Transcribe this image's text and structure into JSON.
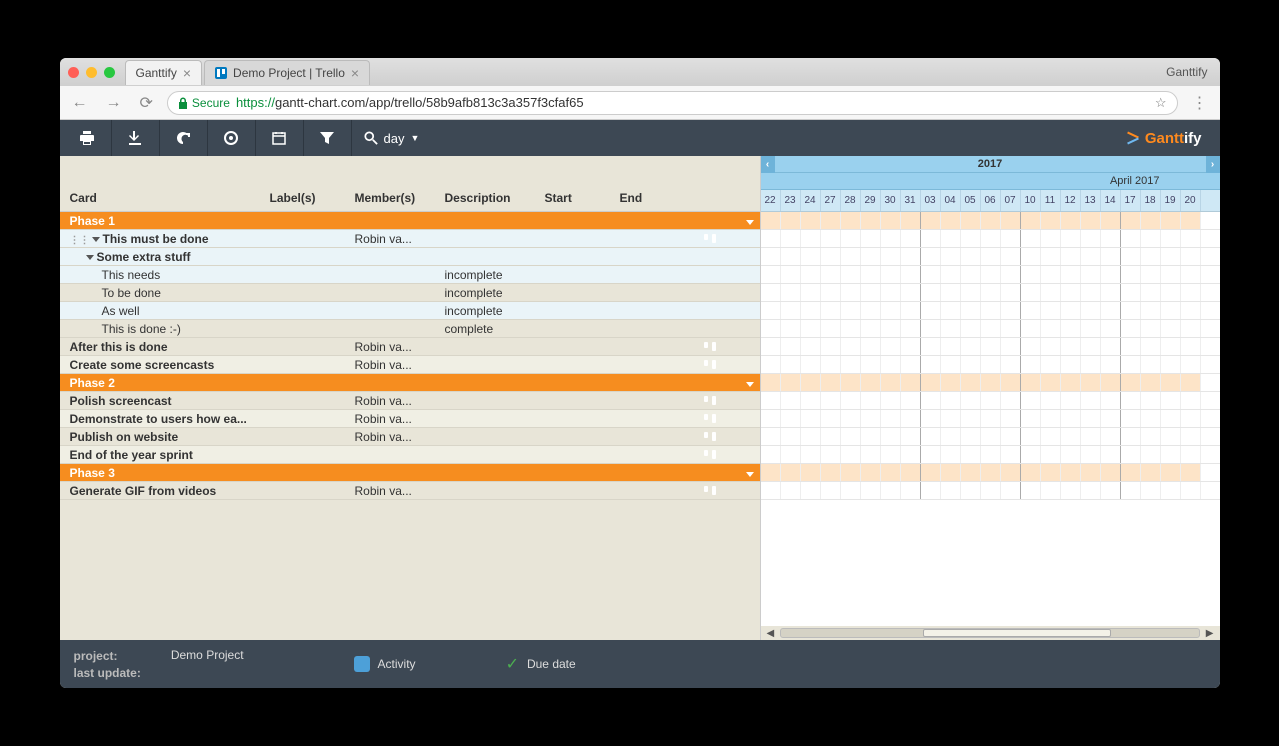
{
  "browser": {
    "tabs": [
      {
        "title": "Ganttify",
        "active": true
      },
      {
        "title": "Demo Project | Trello",
        "active": false
      }
    ],
    "win_label": "Ganttify",
    "secure_label": "Secure",
    "url_https": "https://",
    "url_rest": "gantt-chart.com/app/trello/58b9afb813c3a357f3cfaf65"
  },
  "toolbar": {
    "zoom_label": "day"
  },
  "brand": {
    "part1": "Gantt",
    "part2": "ify"
  },
  "columns": {
    "card": "Card",
    "label": "Label(s)",
    "member": "Member(s)",
    "desc": "Description",
    "start": "Start",
    "end": "End"
  },
  "timeline": {
    "year": "2017",
    "month": "April 2017",
    "days": [
      "22",
      "23",
      "24",
      "27",
      "28",
      "29",
      "30",
      "31",
      "03",
      "04",
      "05",
      "06",
      "07",
      "10",
      "11",
      "12",
      "13",
      "14",
      "17",
      "18",
      "19",
      "20"
    ]
  },
  "rows": [
    {
      "type": "phase",
      "card": "Phase 1"
    },
    {
      "type": "task",
      "card": "This must be done",
      "member": "Robin va...",
      "indent": 1,
      "trello": true,
      "drag": true,
      "lite": true
    },
    {
      "type": "task",
      "card": "Some extra stuff",
      "indent": 2,
      "caret": true,
      "lite": true
    },
    {
      "type": "task",
      "card": "This needs",
      "desc": "incomplete",
      "indent": 3,
      "lite": true
    },
    {
      "type": "task",
      "card": "To be done",
      "desc": "incomplete",
      "indent": 3
    },
    {
      "type": "task",
      "card": "As well",
      "desc": "incomplete",
      "indent": 3,
      "lite": true
    },
    {
      "type": "task",
      "card": "This is done :-)",
      "desc": "complete",
      "indent": 3
    },
    {
      "type": "task",
      "card": "After this is done",
      "member": "Robin va...",
      "indent": 1,
      "trello": true
    },
    {
      "type": "task",
      "card": "Create some screencasts",
      "member": "Robin va...",
      "indent": 1,
      "trello": true,
      "alt": true
    },
    {
      "type": "phase",
      "card": "Phase 2"
    },
    {
      "type": "task",
      "card": "Polish screencast",
      "member": "Robin va...",
      "indent": 1,
      "trello": true
    },
    {
      "type": "task",
      "card": "Demonstrate to users how ea...",
      "member": "Robin va...",
      "indent": 1,
      "trello": true,
      "alt": true
    },
    {
      "type": "task",
      "card": "Publish on website",
      "member": "Robin va...",
      "indent": 1,
      "trello": true
    },
    {
      "type": "task",
      "card": "End of the year sprint",
      "indent": 1,
      "trello": true,
      "alt": true
    },
    {
      "type": "phase",
      "card": "Phase 3"
    },
    {
      "type": "task",
      "card": "Generate GIF from videos",
      "member": "Robin va...",
      "indent": 1,
      "trello": true
    }
  ],
  "footer": {
    "project_label": "project:",
    "project_value": "Demo Project",
    "lastupdate_label": "last update:",
    "activity_label": "Activity",
    "duedate_label": "Due date"
  }
}
